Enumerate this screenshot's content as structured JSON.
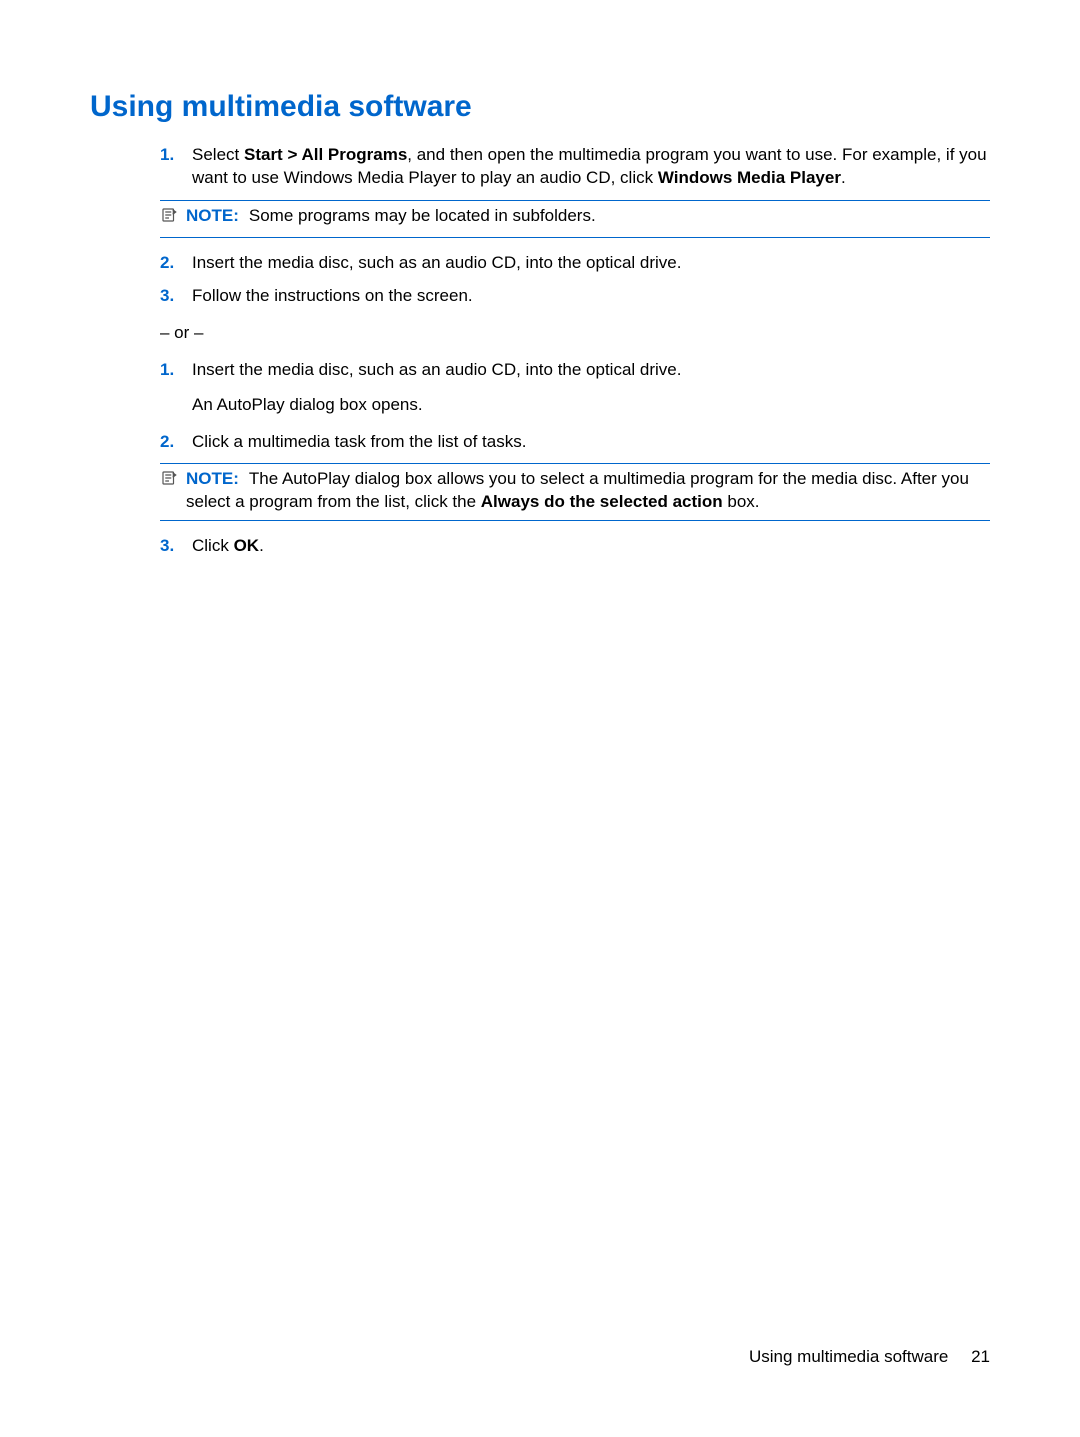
{
  "heading": "Using multimedia software",
  "list1": {
    "n1": "1.",
    "t1a": "Select ",
    "t1b": "Start > All Programs",
    "t1c": ", and then open the multimedia program you want to use. For example, if you want to use Windows Media Player to play an audio CD, click ",
    "t1d": "Windows Media Player",
    "t1e": ".",
    "note1_label": "NOTE:",
    "note1_text": "Some programs may be located in subfolders.",
    "n2": "2.",
    "t2": "Insert the media disc, such as an audio CD, into the optical drive.",
    "n3": "3.",
    "t3": "Follow the instructions on the screen."
  },
  "or": "– or –",
  "list2": {
    "n1": "1.",
    "t1": "Insert the media disc, such as an audio CD, into the optical drive.",
    "sub1": "An AutoPlay dialog box opens.",
    "n2": "2.",
    "t2": "Click a multimedia task from the list of tasks.",
    "note2_label": "NOTE:",
    "note2_text_a": "The AutoPlay dialog box allows you to select a multimedia program for the media disc. After you select a program from the list, click the ",
    "note2_text_b": "Always do the selected action",
    "note2_text_c": " box.",
    "n3": "3.",
    "t3a": "Click ",
    "t3b": "OK",
    "t3c": "."
  },
  "footer_text": "Using multimedia software",
  "footer_page": "21"
}
